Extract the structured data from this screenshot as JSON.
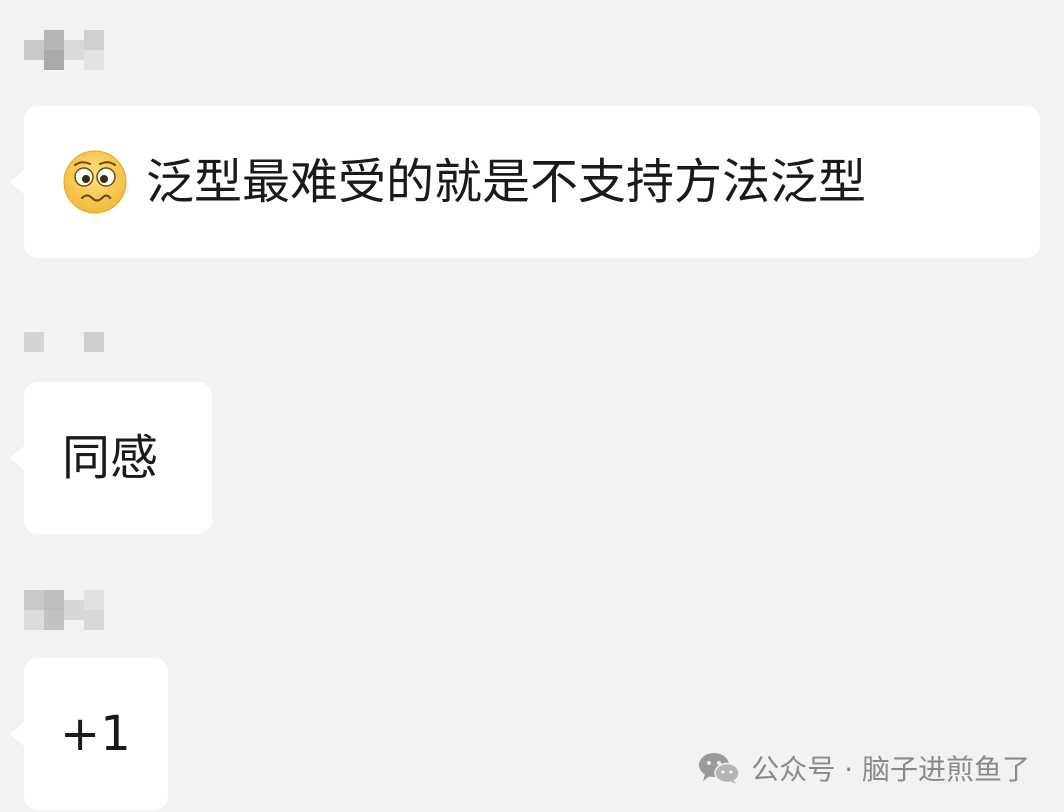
{
  "messages": [
    {
      "text": "泛型最难受的就是不支持方法泛型",
      "emoji": "woozy-face-icon"
    },
    {
      "text": "同感"
    },
    {
      "text": "+1"
    }
  ],
  "watermark": {
    "text": "公众号 · 脑子进煎鱼了",
    "icon": "wechat-icon"
  },
  "colors": {
    "background": "#f2f2f2",
    "bubble": "#ffffff",
    "text": "#1a1a1a",
    "watermark": "#8a8a8a"
  }
}
